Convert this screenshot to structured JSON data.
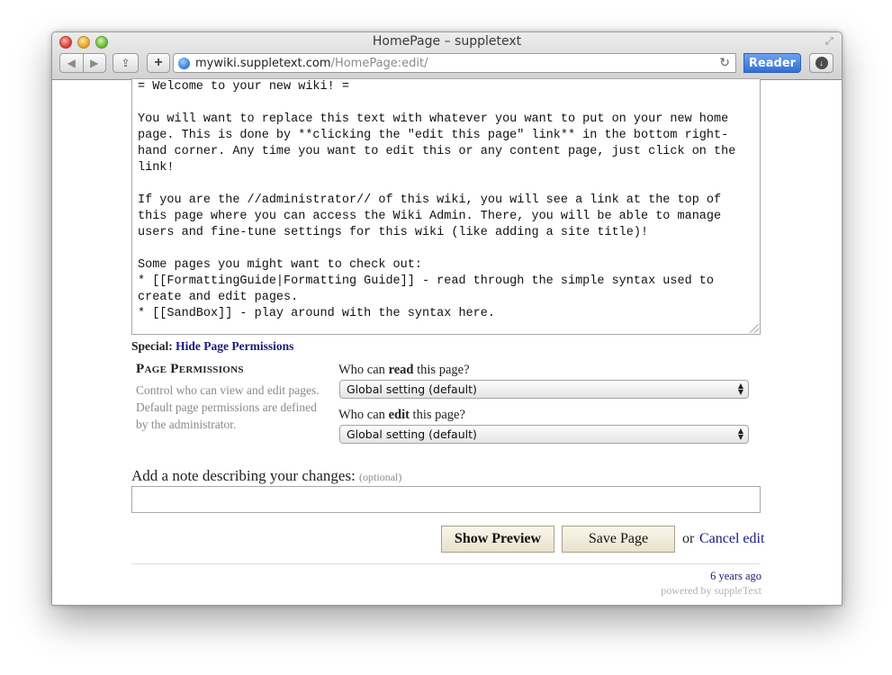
{
  "window": {
    "title": "HomePage – suppletext"
  },
  "toolbar": {
    "url_host": "mywiki.suppletext.com",
    "url_path": "/HomePage:edit/",
    "reader_label": "Reader",
    "icons": [
      "back-arrow",
      "forward-arrow",
      "share",
      "add-tab",
      "globe",
      "reload",
      "download"
    ]
  },
  "editor": {
    "content": "= Welcome to your new wiki! =\n\nYou will want to replace this text with whatever you want to put on your new home page. This is done by **clicking the \"edit this page\" link** in the bottom right-hand corner. Any time you want to edit this or any content page, just click on the link!\n\nIf you are the //administrator// of this wiki, you will see a link at the top of this page where you can access the Wiki Admin. There, you will be able to manage users and fine-tune settings for this wiki (like adding a site title)!\n\nSome pages you might want to check out:\n* [[FormattingGuide|Formatting Guide]] - read through the simple syntax used to create and edit pages.\n* [[SandBox]] - play around with the syntax here."
  },
  "special": {
    "label": "Special:",
    "link": "Hide Page Permissions"
  },
  "permissions": {
    "title": "Page Permissions",
    "description": "Control who can view and edit pages. Default page permissions are defined by the administrator.",
    "read_question_pre": "Who can ",
    "read_question_bold": "read",
    "read_question_post": " this page?",
    "read_value": "Global setting (default)",
    "edit_question_pre": "Who can ",
    "edit_question_bold": "edit",
    "edit_question_post": " this page?",
    "edit_value": "Global setting (default)"
  },
  "note": {
    "label": "Add a note describing your changes:",
    "optional": "(optional)",
    "value": ""
  },
  "actions": {
    "preview_label": "Show Preview",
    "save_label": "Save Page",
    "or_text": "or",
    "cancel_label": "Cancel edit"
  },
  "footer": {
    "modified": "6 years ago",
    "powered": "powered by suppleText"
  }
}
